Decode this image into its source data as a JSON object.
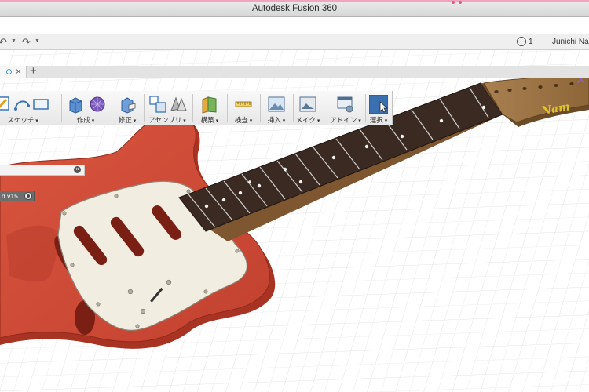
{
  "window": {
    "title": "Autodesk Fusion 360"
  },
  "quick_access": {
    "jobs_count": "1",
    "user_name": "Junichi Naga"
  },
  "toolbar": {
    "groups": [
      {
        "label": "スケッチ",
        "icon": "sketch-icon"
      },
      {
        "label": "作成",
        "icon": "create-icon"
      },
      {
        "label": "修正",
        "icon": "modify-icon"
      },
      {
        "label": "アセンブリ",
        "icon": "assemble-icon"
      },
      {
        "label": "構築",
        "icon": "construct-icon"
      },
      {
        "label": "検査",
        "icon": "inspect-icon"
      },
      {
        "label": "挿入",
        "icon": "insert-icon"
      },
      {
        "label": "メイク",
        "icon": "make-icon"
      },
      {
        "label": "アドイン",
        "icon": "addins-icon"
      },
      {
        "label": "選択",
        "icon": "select-icon"
      }
    ]
  },
  "browser": {
    "component_label": "d v15"
  },
  "model": {
    "headstock_logo": "Nam",
    "body_color": "#cf4a35",
    "fretboard_color": "#3a2a22",
    "pickguard_color": "#f1ede0"
  }
}
